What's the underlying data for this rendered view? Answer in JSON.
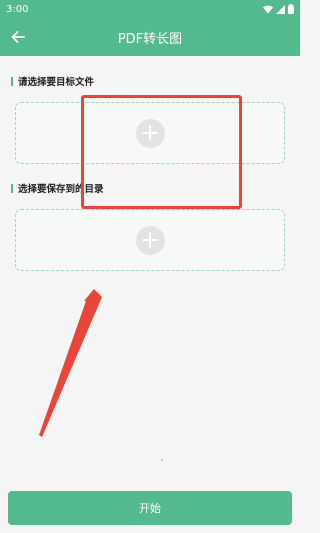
{
  "status_bar": {
    "time": "3:00",
    "icons": [
      "wifi-icon",
      "signal-icon",
      "battery-icon"
    ]
  },
  "app_bar": {
    "title": "PDF转长图",
    "back_icon": "arrow-left-icon"
  },
  "sections": [
    {
      "label": "请选择要目标文件",
      "action_icon": "plus-circle-icon"
    },
    {
      "label": "选择要保存到的目录",
      "action_icon": "plus-circle-icon"
    }
  ],
  "start_button": {
    "label": "开始"
  },
  "colors": {
    "primary": "#53ba8e",
    "annotation": "#e84638",
    "background": "#f5f5f5"
  }
}
